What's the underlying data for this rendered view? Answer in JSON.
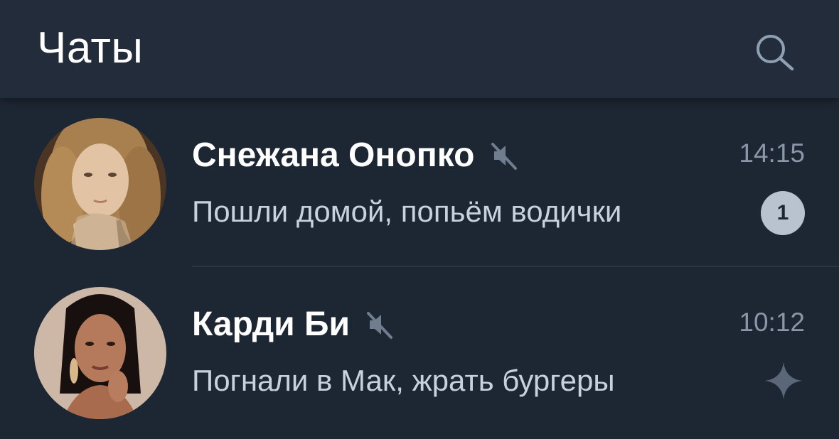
{
  "header": {
    "title": "Чаты",
    "search_icon": "search-icon"
  },
  "chats": [
    {
      "name": "Снежана Онопко",
      "muted": true,
      "time": "14:15",
      "message": "Пошли домой, попьём водички",
      "unread": "1",
      "avatar_palette": [
        "#a07a4e",
        "#d9b48a",
        "#5a3b22"
      ]
    },
    {
      "name": "Карди Би",
      "muted": true,
      "time": "10:12",
      "message": "Погнали в Мак, жрать бургеры",
      "status_icon": "sparkle-icon",
      "avatar_palette": [
        "#c9b4a4",
        "#1c1412",
        "#b57a5b"
      ]
    }
  ],
  "colors": {
    "background": "#1d2633",
    "header_bg": "#222c3a",
    "accent": "#8fa0b4",
    "muted_text": "#8a97a8",
    "badge_bg": "#b9c3cf"
  }
}
